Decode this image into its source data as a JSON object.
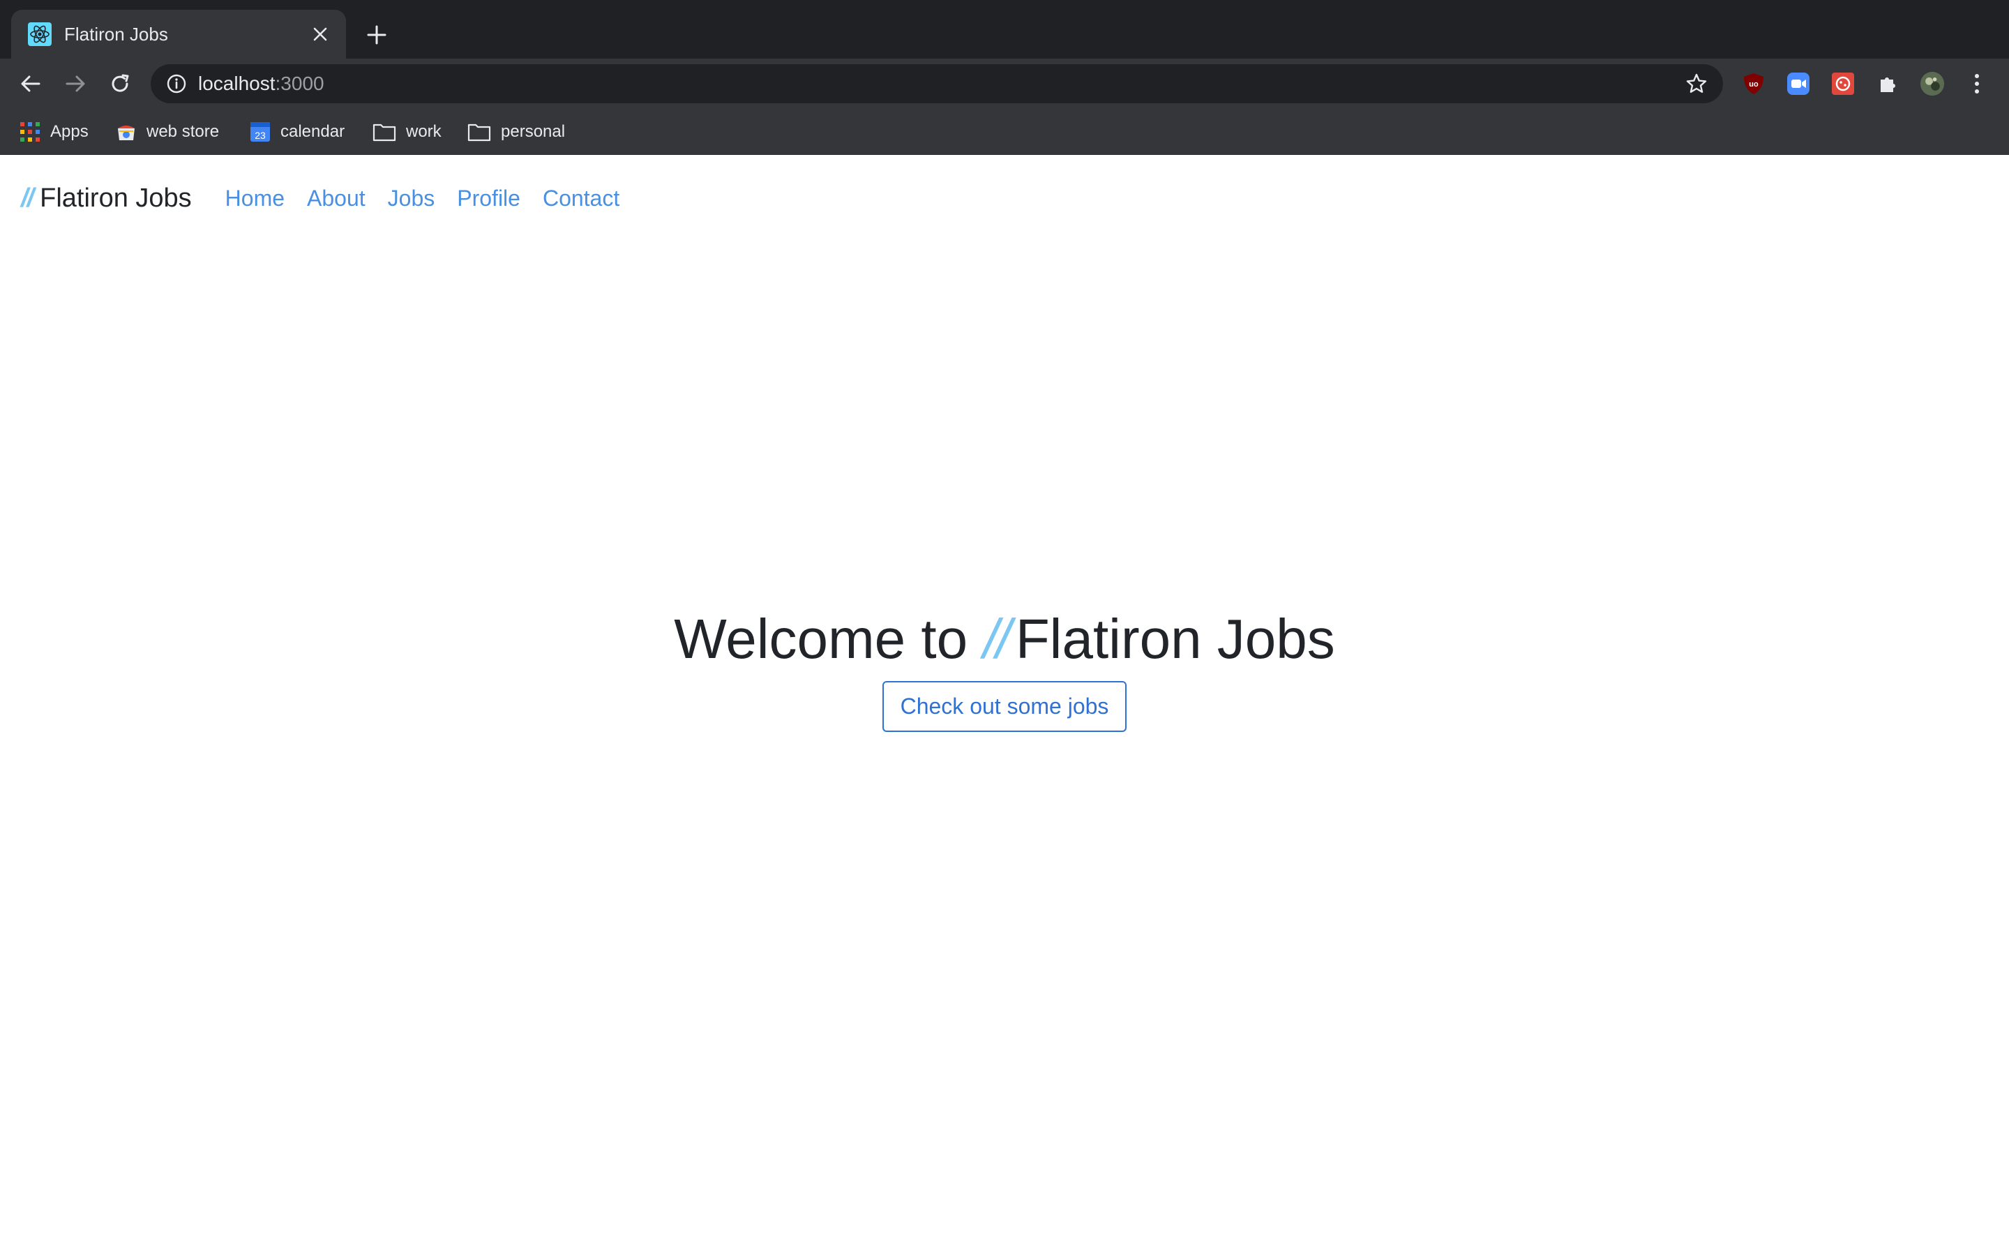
{
  "browser": {
    "tab": {
      "title": "Flatiron Jobs"
    },
    "address": {
      "host": "localhost",
      "port": ":3000"
    },
    "bookmarks": [
      {
        "label": "Apps",
        "icon": "apps-grid-icon"
      },
      {
        "label": "web store",
        "icon": "webstore-icon"
      },
      {
        "label": "calendar",
        "icon": "calendar-icon",
        "badge": "23"
      },
      {
        "label": "work",
        "icon": "folder-icon"
      },
      {
        "label": "personal",
        "icon": "folder-icon"
      }
    ],
    "extensions": [
      "ublock-icon",
      "zoom-icon",
      "cookie-extension-icon",
      "puzzle-extensions-icon",
      "profile-avatar",
      "kebab-menu-icon"
    ]
  },
  "navbar": {
    "brand_mark": "//",
    "brand_name": "Flatiron Jobs",
    "links": [
      "Home",
      "About",
      "Jobs",
      "Profile",
      "Contact"
    ]
  },
  "hero": {
    "title_prefix": "Welcome to",
    "title_mark": "//",
    "title_suffix": "Flatiron Jobs",
    "cta_label": "Check out some jobs"
  },
  "colors": {
    "chrome_dark": "#202124",
    "chrome_toolbar": "#35363a",
    "link_blue": "#4a90e2",
    "button_blue": "#2f72d4",
    "slash_blue": "#7cc7f2",
    "text_dark": "#212529"
  }
}
